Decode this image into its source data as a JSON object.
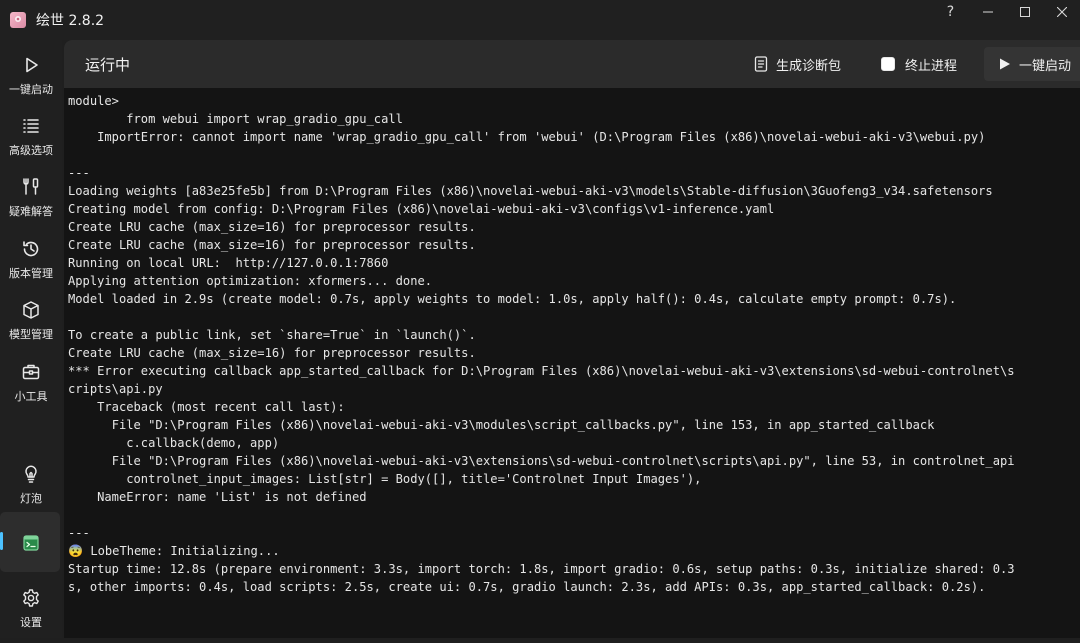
{
  "window": {
    "title": "绘世 2.8.2",
    "controls": {
      "help": "?",
      "minimize": "—",
      "maximize": "☐",
      "close": "✕"
    }
  },
  "sidebar": {
    "items": [
      {
        "label": "一键启动",
        "icon": "play-icon"
      },
      {
        "label": "高级选项",
        "icon": "list-icon"
      },
      {
        "label": "疑难解答",
        "icon": "tools-icon"
      },
      {
        "label": "版本管理",
        "icon": "history-icon"
      },
      {
        "label": "模型管理",
        "icon": "cube-icon"
      },
      {
        "label": "小工具",
        "icon": "toolbox-icon"
      },
      {
        "label": "灯泡",
        "icon": "lightbulb-icon"
      },
      {
        "label": "",
        "icon": "console-icon",
        "active": true
      },
      {
        "label": "设置",
        "icon": "gear-icon"
      }
    ]
  },
  "header": {
    "title": "运行中",
    "diagnostic_label": "生成诊断包",
    "terminate_label": "终止进程",
    "terminate_checked": false,
    "launch_label": "一键启动"
  },
  "console": {
    "lines": [
      "module>",
      "        from webui import wrap_gradio_gpu_call",
      "    ImportError: cannot import name 'wrap_gradio_gpu_call' from 'webui' (D:\\Program Files (x86)\\novelai-webui-aki-v3\\webui.py)",
      "",
      "---",
      "Loading weights [a83e25fe5b] from D:\\Program Files (x86)\\novelai-webui-aki-v3\\models\\Stable-diffusion\\3Guofeng3_v34.safetensors",
      "Creating model from config: D:\\Program Files (x86)\\novelai-webui-aki-v3\\configs\\v1-inference.yaml",
      "Create LRU cache (max_size=16) for preprocessor results.",
      "Create LRU cache (max_size=16) for preprocessor results.",
      "Running on local URL:  http://127.0.0.1:7860",
      "Applying attention optimization: xformers... done.",
      "Model loaded in 2.9s (create model: 0.7s, apply weights to model: 1.0s, apply half(): 0.4s, calculate empty prompt: 0.7s).",
      "",
      "To create a public link, set `share=True` in `launch()`.",
      "Create LRU cache (max_size=16) for preprocessor results.",
      "*** Error executing callback app_started_callback for D:\\Program Files (x86)\\novelai-webui-aki-v3\\extensions\\sd-webui-controlnet\\s",
      "cripts\\api.py",
      "    Traceback (most recent call last):",
      "      File \"D:\\Program Files (x86)\\novelai-webui-aki-v3\\modules\\script_callbacks.py\", line 153, in app_started_callback",
      "        c.callback(demo, app)",
      "      File \"D:\\Program Files (x86)\\novelai-webui-aki-v3\\extensions\\sd-webui-controlnet\\scripts\\api.py\", line 53, in controlnet_api",
      "        controlnet_input_images: List[str] = Body([], title='Controlnet Input Images'),",
      "    NameError: name 'List' is not defined",
      "",
      "---",
      "😨 LobeTheme: Initializing...",
      "Startup time: 12.8s (prepare environment: 3.3s, import torch: 1.8s, import gradio: 0.6s, setup paths: 0.3s, initialize shared: 0.3",
      "s, other imports: 0.4s, load scripts: 2.5s, create ui: 0.7s, gradio launch: 2.3s, add APIs: 0.3s, app_started_callback: 0.2s)."
    ]
  }
}
